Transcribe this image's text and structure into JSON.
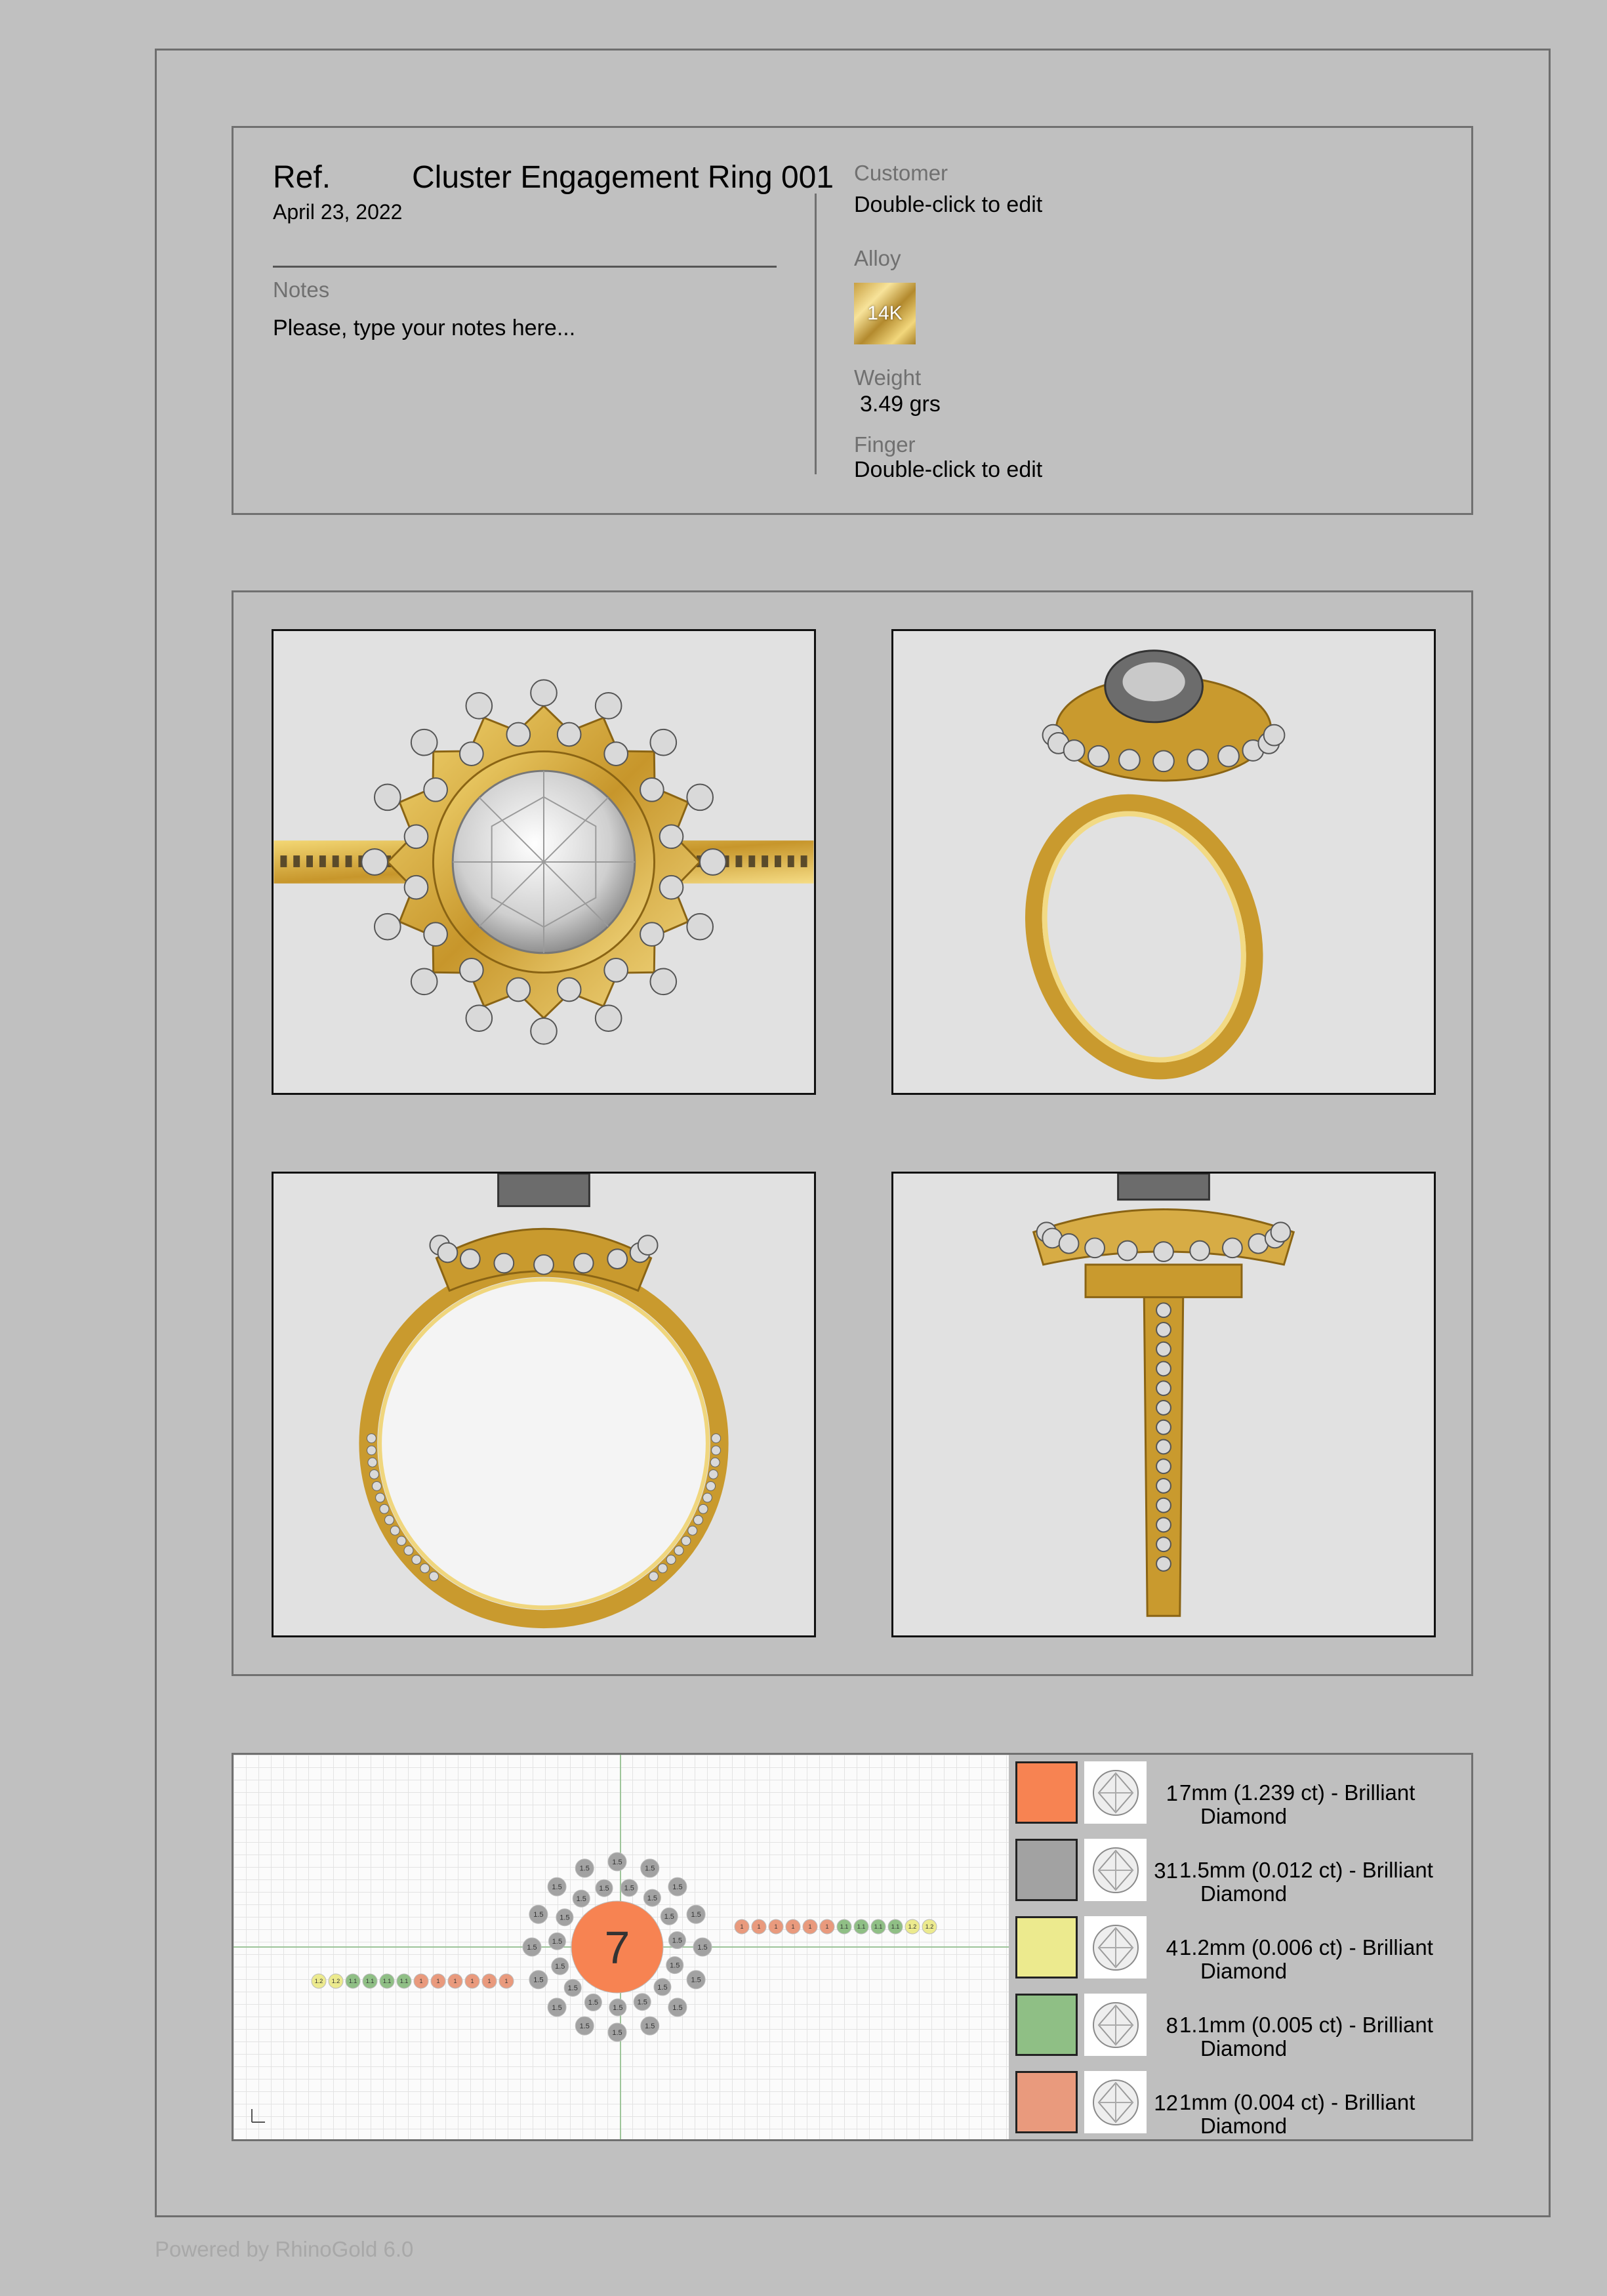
{
  "header": {
    "ref_label": "Ref.",
    "title": "Cluster Engagement Ring 001",
    "date": "April 23, 2022",
    "notes_label": "Notes",
    "notes_placeholder": "Please, type your notes here...",
    "customer_label": "Customer",
    "customer_value": "Double-click to edit",
    "alloy_label": "Alloy",
    "alloy_value": "14K",
    "weight_label": "Weight",
    "weight_value": "3.49 grs",
    "finger_label": "Finger",
    "finger_value": "Double-click to edit"
  },
  "views": [
    "top-view",
    "perspective-view",
    "front-view",
    "side-view"
  ],
  "colors": {
    "gold": "#d4a935",
    "gold_dark": "#8a6414",
    "diamond": "#d9d9d9",
    "stone_7mm": "#f78352",
    "stone_15mm": "#a2a2a2",
    "stone_12mm": "#ecea8e",
    "stone_11mm": "#8fbf85",
    "stone_1mm": "#e99a7d"
  },
  "layout_map": {
    "center_label": "7",
    "halo_label": "1.5",
    "shank_left_labels": [
      "1.2",
      "1.2",
      "1.1",
      "1.1",
      "1.1",
      "1.1",
      "1",
      "1",
      "1",
      "1",
      "1",
      "1"
    ],
    "shank_right_labels": [
      "1",
      "1",
      "1",
      "1",
      "1",
      "1",
      "1.1",
      "1.1",
      "1.1",
      "1.1",
      "1.2",
      "1.2"
    ]
  },
  "stones": [
    {
      "count": "1",
      "desc_line1": "7mm (1.239 ct) - Brilliant",
      "desc_line2": "Diamond",
      "color": "#f78352"
    },
    {
      "count": "31",
      "desc_line1": "1.5mm (0.012 ct) - Brilliant",
      "desc_line2": "Diamond",
      "color": "#a2a2a2"
    },
    {
      "count": "4",
      "desc_line1": "1.2mm (0.006 ct) - Brilliant",
      "desc_line2": "Diamond",
      "color": "#ecea8e"
    },
    {
      "count": "8",
      "desc_line1": "1.1mm (0.005 ct) - Brilliant",
      "desc_line2": "Diamond",
      "color": "#8fbf85"
    },
    {
      "count": "12",
      "desc_line1": "1mm (0.004 ct) - Brilliant",
      "desc_line2": "Diamond",
      "color": "#e99a7d"
    }
  ],
  "footer": "Powered by RhinoGold 6.0"
}
